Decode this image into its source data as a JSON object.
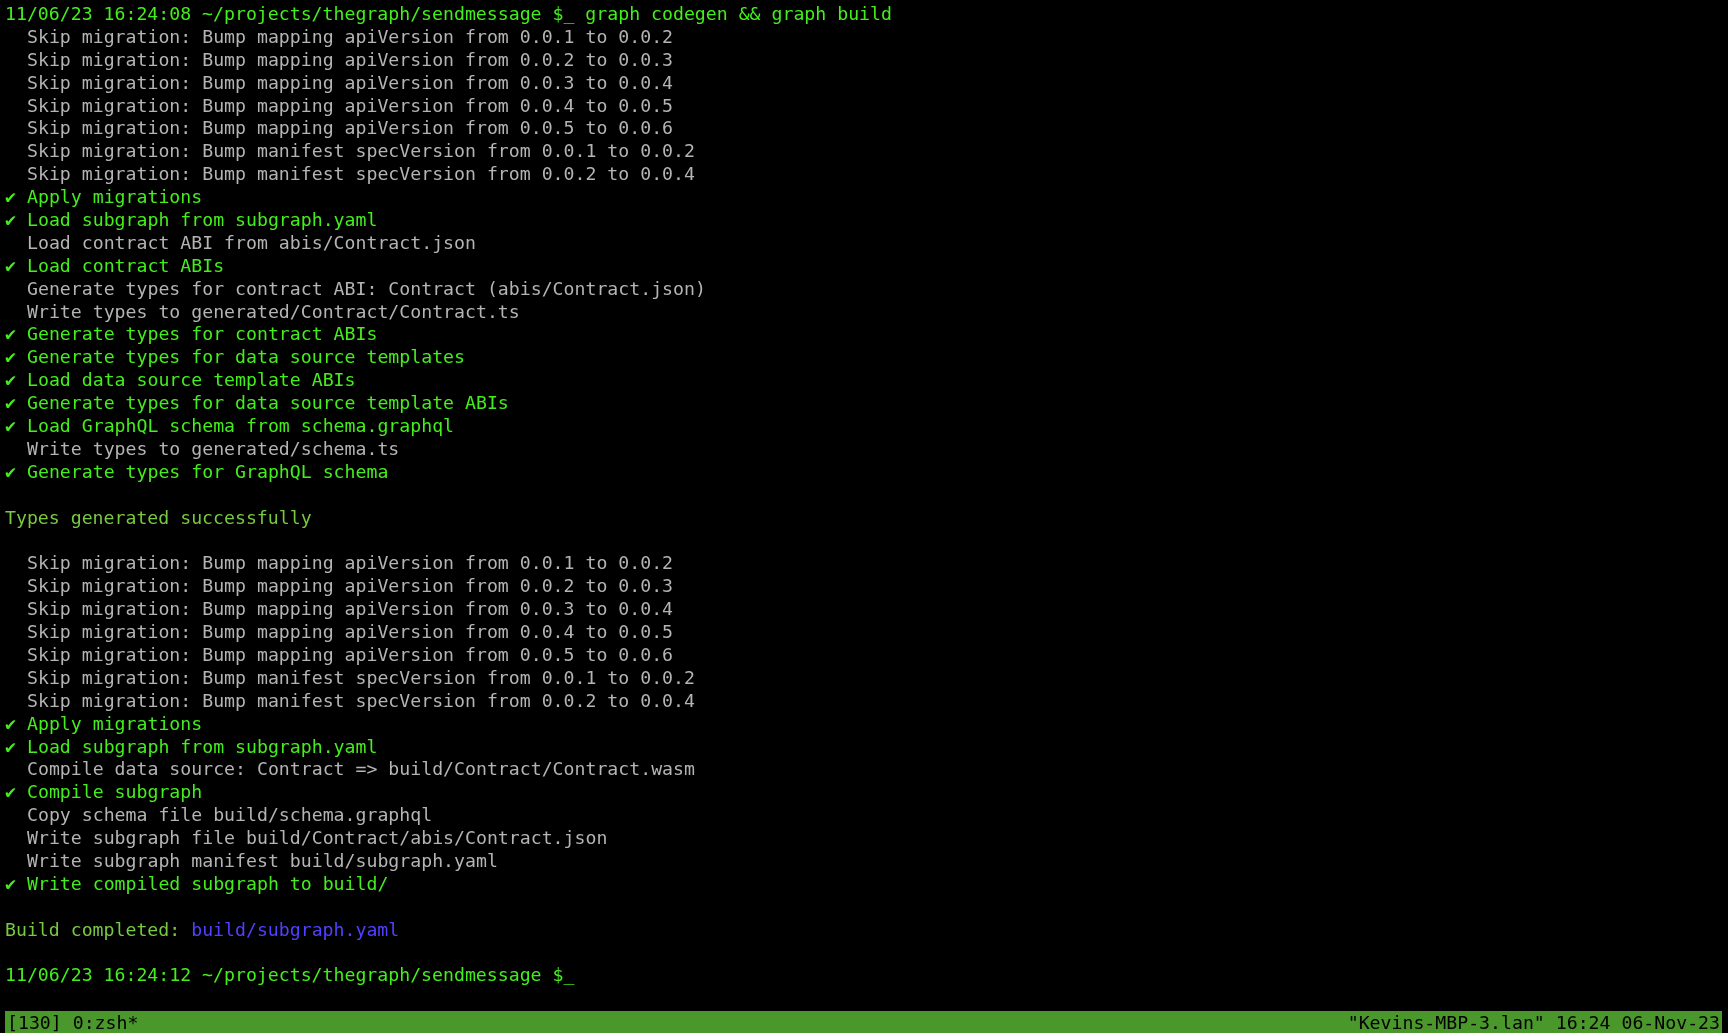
{
  "terminal": {
    "lines": [
      {
        "kind": "prompt",
        "text": "11/06/23 16:24:08 ~/projects/thegraph/sendmessage $_ graph codegen && graph build"
      },
      {
        "kind": "info",
        "text": "Skip migration: Bump mapping apiVersion from 0.0.1 to 0.0.2"
      },
      {
        "kind": "info",
        "text": "Skip migration: Bump mapping apiVersion from 0.0.2 to 0.0.3"
      },
      {
        "kind": "info",
        "text": "Skip migration: Bump mapping apiVersion from 0.0.3 to 0.0.4"
      },
      {
        "kind": "info",
        "text": "Skip migration: Bump mapping apiVersion from 0.0.4 to 0.0.5"
      },
      {
        "kind": "info",
        "text": "Skip migration: Bump mapping apiVersion from 0.0.5 to 0.0.6"
      },
      {
        "kind": "info",
        "text": "Skip migration: Bump manifest specVersion from 0.0.1 to 0.0.2"
      },
      {
        "kind": "info",
        "text": "Skip migration: Bump manifest specVersion from 0.0.2 to 0.0.4"
      },
      {
        "kind": "success",
        "mark": "✔",
        "text": "Apply migrations"
      },
      {
        "kind": "success",
        "mark": "✔",
        "text": "Load subgraph from subgraph.yaml"
      },
      {
        "kind": "info",
        "text": "Load contract ABI from abis/Contract.json"
      },
      {
        "kind": "success",
        "mark": "✔",
        "text": "Load contract ABIs"
      },
      {
        "kind": "info",
        "text": "Generate types for contract ABI: Contract (abis/Contract.json)"
      },
      {
        "kind": "info",
        "text": "Write types to generated/Contract/Contract.ts"
      },
      {
        "kind": "success",
        "mark": "✔",
        "text": "Generate types for contract ABIs"
      },
      {
        "kind": "success",
        "mark": "✔",
        "text": "Generate types for data source templates"
      },
      {
        "kind": "success",
        "mark": "✔",
        "text": "Load data source template ABIs"
      },
      {
        "kind": "success",
        "mark": "✔",
        "text": "Generate types for data source template ABIs"
      },
      {
        "kind": "success",
        "mark": "✔",
        "text": "Load GraphQL schema from schema.graphql"
      },
      {
        "kind": "info",
        "text": "Write types to generated/schema.ts"
      },
      {
        "kind": "success",
        "mark": "✔",
        "text": "Generate types for GraphQL schema"
      },
      {
        "kind": "blank"
      },
      {
        "kind": "result",
        "text": "Types generated successfully"
      },
      {
        "kind": "blank"
      },
      {
        "kind": "info",
        "text": "Skip migration: Bump mapping apiVersion from 0.0.1 to 0.0.2"
      },
      {
        "kind": "info",
        "text": "Skip migration: Bump mapping apiVersion from 0.0.2 to 0.0.3"
      },
      {
        "kind": "info",
        "text": "Skip migration: Bump mapping apiVersion from 0.0.3 to 0.0.4"
      },
      {
        "kind": "info",
        "text": "Skip migration: Bump mapping apiVersion from 0.0.4 to 0.0.5"
      },
      {
        "kind": "info",
        "text": "Skip migration: Bump mapping apiVersion from 0.0.5 to 0.0.6"
      },
      {
        "kind": "info",
        "text": "Skip migration: Bump manifest specVersion from 0.0.1 to 0.0.2"
      },
      {
        "kind": "info",
        "text": "Skip migration: Bump manifest specVersion from 0.0.2 to 0.0.4"
      },
      {
        "kind": "success",
        "mark": "✔",
        "text": "Apply migrations"
      },
      {
        "kind": "success",
        "mark": "✔",
        "text": "Load subgraph from subgraph.yaml"
      },
      {
        "kind": "info",
        "text": "Compile data source: Contract => build/Contract/Contract.wasm"
      },
      {
        "kind": "success",
        "mark": "✔",
        "text": "Compile subgraph"
      },
      {
        "kind": "info",
        "text": "Copy schema file build/schema.graphql"
      },
      {
        "kind": "info",
        "text": "Write subgraph file build/Contract/abis/Contract.json"
      },
      {
        "kind": "info",
        "text": "Write subgraph manifest build/subgraph.yaml"
      },
      {
        "kind": "success",
        "mark": "✔",
        "text": "Write compiled subgraph to build/"
      },
      {
        "kind": "blank"
      },
      {
        "kind": "build",
        "text": "Build completed:",
        "link": "build/subgraph.yaml"
      },
      {
        "kind": "blank"
      },
      {
        "kind": "prompt",
        "text": "11/06/23 16:24:12 ~/projects/thegraph/sendmessage $_"
      }
    ]
  },
  "status_bar": {
    "left": "[130] 0:zsh*",
    "right": "\"Kevins-MBP-3.lan\" 16:24 06-Nov-23"
  }
}
